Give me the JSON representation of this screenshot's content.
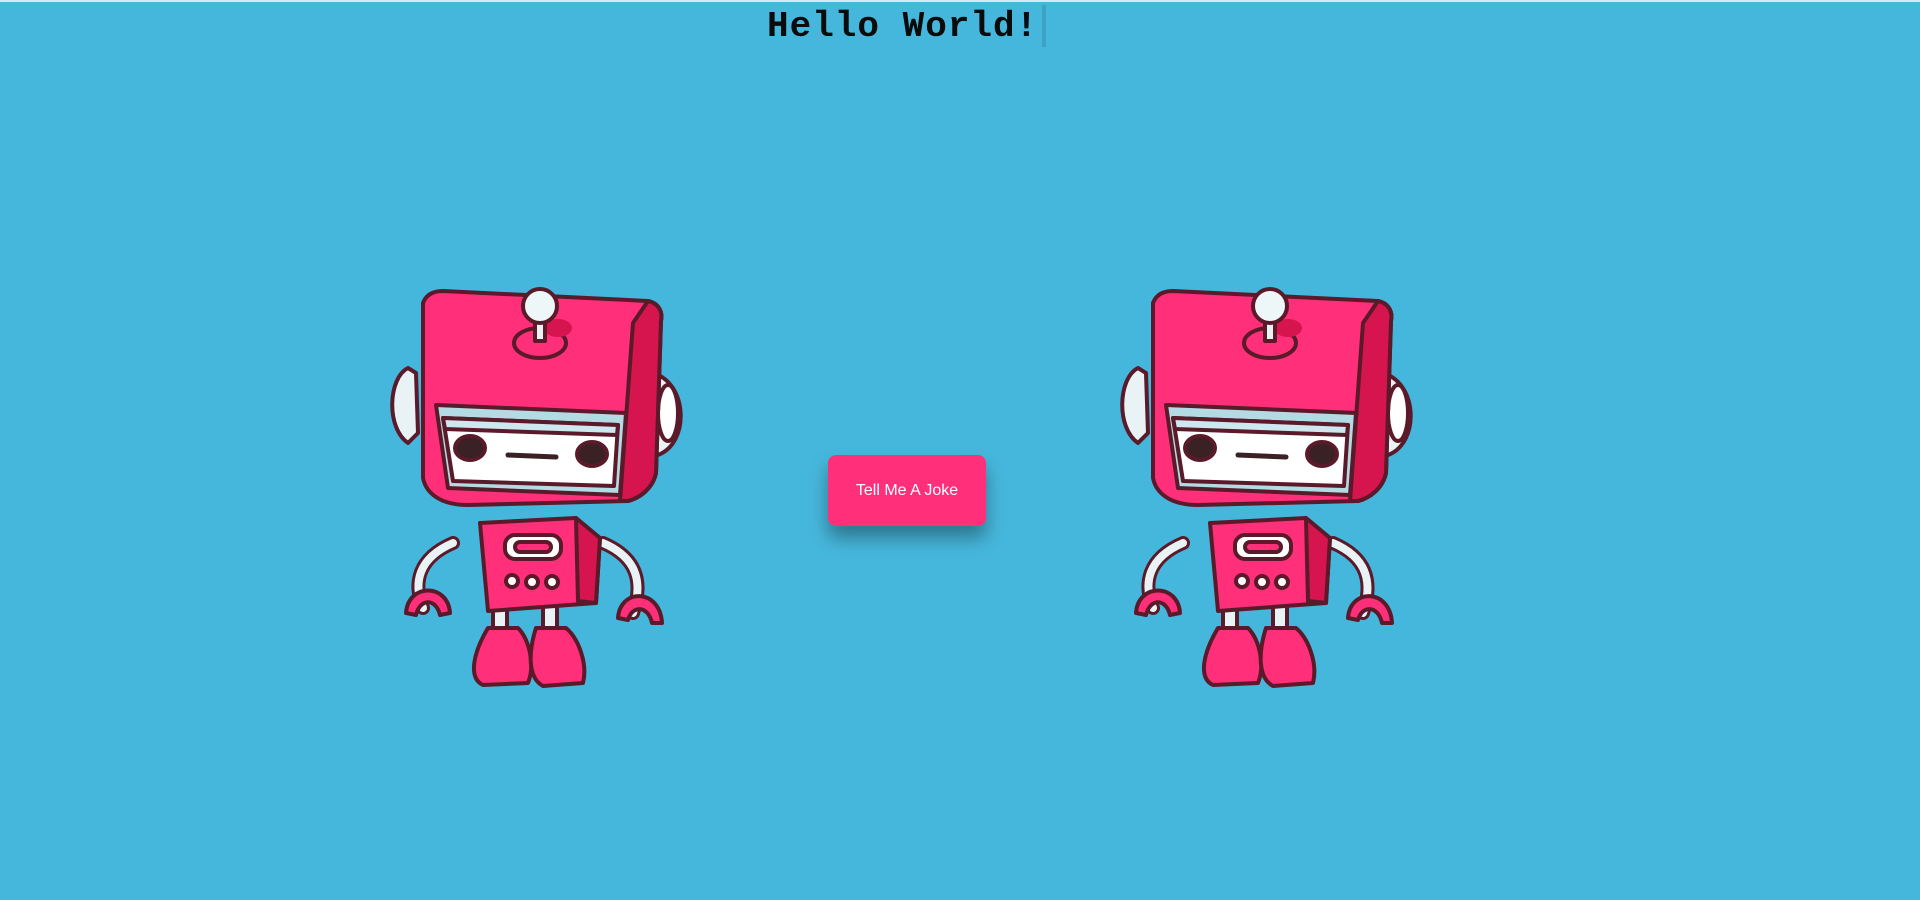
{
  "header": {
    "headline": "Hello World!"
  },
  "main": {
    "joke_button_label": "Tell Me A Joke"
  },
  "colors": {
    "background": "#46b7dc",
    "button": "#ff2f79",
    "robot_body": "#ff2f79",
    "robot_shade": "#d6154e"
  },
  "images": {
    "left": "robot-illustration",
    "right": "robot-illustration"
  }
}
